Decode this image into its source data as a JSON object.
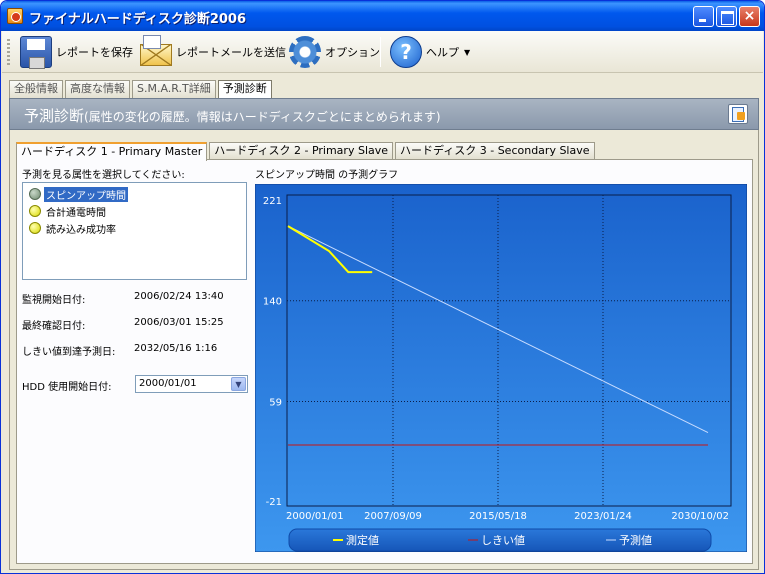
{
  "window": {
    "title": "ファイナルハードディスク診断2006",
    "close_glyph": "×"
  },
  "toolbar": {
    "save_label": "レポートを保存",
    "mail_label": "レポートメールを送信",
    "options_label": "オプション",
    "help_label": "ヘルプ",
    "help_caret": "▼",
    "help_glyph": "?"
  },
  "icons": {
    "save": "floppy-disk-icon",
    "mail": "envelope-icon",
    "options": "gear-icon",
    "help": "question-circle-icon",
    "export": "report-export-icon",
    "attribute_good": "gray-circle-icon",
    "attribute_warn": "yellow-circle-icon"
  },
  "main_tabs": [
    "全般情報",
    "高度な情報",
    "S.M.A.R.T詳細",
    "予測診断"
  ],
  "header": {
    "title": "予測診断",
    "subtitle": "(属性の変化の履歴。情報はハードディスクごとにまとめられます)"
  },
  "disk_tabs": [
    "ハードディスク 1 - Primary Master",
    "ハードディスク 2 - Primary Slave",
    "ハードディスク 3 - Secondary Slave"
  ],
  "attributes": {
    "label": "予測を見る属性を選択してください:",
    "items": [
      "スピンアップ時間",
      "合計通電時間",
      "読み込み成功率"
    ]
  },
  "info": {
    "monitor_start_label": "監視開始日付:",
    "monitor_start_value": "2006/02/24 13:40",
    "last_check_label": "最終確認日付:",
    "last_check_value": "2006/03/01 15:25",
    "threshold_label": "しきい値到達予測日:",
    "threshold_value": "2032/05/16 1:16",
    "hdd_start_label": "HDD 使用開始日付:",
    "hdd_start_value": "2000/01/01",
    "hdd_start_caret": "▼"
  },
  "colors": {
    "plot_bg": "#1f6fd2",
    "measured": "#ffff00",
    "threshold": "#c81414",
    "predicted": "#c8dcff"
  },
  "chart_data": {
    "type": "line",
    "title": "スピンアップ時間 の予測グラフ",
    "x_ticks": [
      "2000/01/01",
      "2007/09/09",
      "2015/05/18",
      "2023/01/24",
      "2030/10/02"
    ],
    "y_ticks": [
      221,
      140,
      59,
      -21
    ],
    "ylim": [
      -21,
      221
    ],
    "grid": true,
    "legend_position": "bottom",
    "series": [
      {
        "name": "測定値",
        "x": [
          "2000/01/01",
          "2003/01/01",
          "2004/06/01",
          "2006/03/01"
        ],
        "y": [
          200,
          180,
          163,
          163
        ]
      },
      {
        "name": "しきい値",
        "x": [
          "2000/01/01",
          "2030/10/02"
        ],
        "y": [
          24,
          24
        ]
      },
      {
        "name": "予測値",
        "x": [
          "2000/01/01",
          "2030/10/02"
        ],
        "y": [
          200,
          34
        ]
      }
    ]
  }
}
